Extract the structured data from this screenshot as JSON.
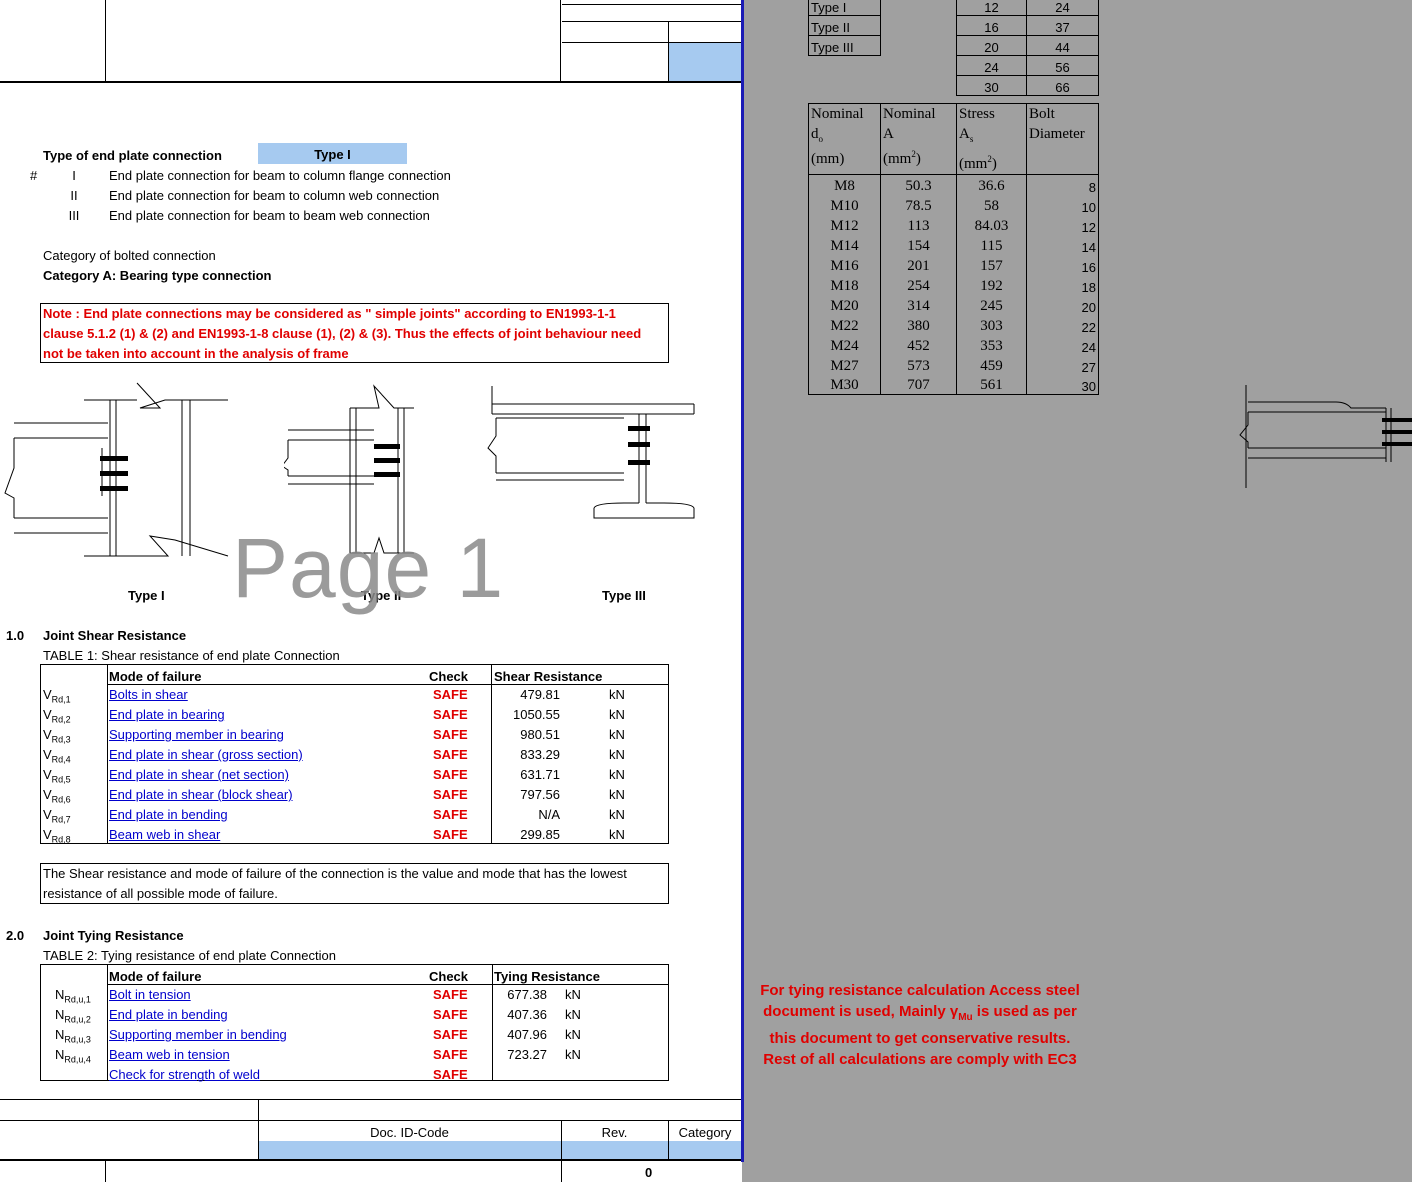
{
  "top_table": [
    {
      "type": "Type I",
      "d": "12",
      "dw": "24"
    },
    {
      "type": "Type II",
      "d": "16",
      "dw": "37"
    },
    {
      "type": "Type III",
      "d": "20",
      "dw": "44"
    },
    {
      "type": "",
      "d": "24",
      "dw": "56"
    },
    {
      "type": "",
      "d": "30",
      "dw": "66"
    }
  ],
  "bolt_table": {
    "headers": [
      "Nominal d₀ (mm)",
      "Nominal A (mm²)",
      "Stress Aₛ (mm²)",
      "Bolt Diameter"
    ],
    "rows": [
      [
        "M8",
        "50.3",
        "36.6",
        "8"
      ],
      [
        "M10",
        "78.5",
        "58",
        "10"
      ],
      [
        "M12",
        "113",
        "84.03",
        "12"
      ],
      [
        "M14",
        "154",
        "115",
        "14"
      ],
      [
        "M16",
        "201",
        "157",
        "16"
      ],
      [
        "M18",
        "254",
        "192",
        "18"
      ],
      [
        "M20",
        "314",
        "245",
        "20"
      ],
      [
        "M22",
        "380",
        "303",
        "22"
      ],
      [
        "M24",
        "452",
        "353",
        "24"
      ],
      [
        "M27",
        "573",
        "459",
        "27"
      ],
      [
        "M30",
        "707",
        "561",
        "30"
      ]
    ]
  },
  "connection": {
    "type_label": "Type of end plate connection",
    "type_value": "Type I",
    "hash": "#",
    "options": [
      {
        "num": "I",
        "text": "End plate connection for beam to column flange connection"
      },
      {
        "num": "II",
        "text": "End plate connection for beam to column web connection"
      },
      {
        "num": "III",
        "text": "End plate connection for beam to beam web connection"
      }
    ],
    "category_label": "Category of bolted connection",
    "category_value": "Category A: Bearing type connection",
    "note_line1": "Note : End plate connections may be considered as \" simple joints\" according to EN1993-1-1",
    "note_line2": "clause 5.1.2 (1) & (2) and EN1993-1-8 clause (1), (2) & (3). Thus the effects of joint behaviour need",
    "note_line3": "not be taken into account in the analysis of frame"
  },
  "figures": {
    "type1": "Type I",
    "type2": "Type II",
    "type3": "Type III"
  },
  "watermark": "Page 1",
  "section1": {
    "num": "1.0",
    "title": "Joint Shear Resistance",
    "table_title": "TABLE 1: Shear resistance of end plate Connection",
    "col_mode": "Mode of failure",
    "col_check": "Check",
    "col_res": "Shear Resistance",
    "rows": [
      {
        "sym": "V",
        "sub": "Rd,1",
        "mode": "Bolts in shear ",
        "check": "SAFE",
        "val": "479.81",
        "unit": "kN"
      },
      {
        "sym": "V",
        "sub": "Rd,2",
        "mode": "End plate in bearing",
        "check": "SAFE",
        "val": "1050.55",
        "unit": "kN"
      },
      {
        "sym": "V",
        "sub": "Rd,3",
        "mode": "Supporting member in bearing",
        "check": "SAFE",
        "val": "980.51",
        "unit": "kN"
      },
      {
        "sym": "V",
        "sub": "Rd,4",
        "mode": "End plate in shear (gross section)",
        "check": "SAFE",
        "val": "833.29",
        "unit": "kN"
      },
      {
        "sym": "V",
        "sub": "Rd,5",
        "mode": "End plate in shear (net section)",
        "check": "SAFE",
        "val": "631.71",
        "unit": "kN"
      },
      {
        "sym": "V",
        "sub": "Rd,6",
        "mode": "End plate in shear (block shear)",
        "check": "SAFE",
        "val": "797.56",
        "unit": "kN"
      },
      {
        "sym": "V",
        "sub": "Rd,7",
        "mode": "End plate in bending",
        "check": "SAFE",
        "val": "N/A",
        "unit": "kN"
      },
      {
        "sym": "V",
        "sub": "Rd,8",
        "mode": "Beam web in shear",
        "check": "SAFE",
        "val": "299.85",
        "unit": "kN"
      }
    ],
    "info_line1": "The Shear resistance and mode of failure of the connection is the value and mode that has the lowest",
    "info_line2": "resistance of all possible mode of failure."
  },
  "section2": {
    "num": "2.0",
    "title": "Joint Tying Resistance",
    "table_title": "TABLE 2: Tying resistance of end plate Connection",
    "col_mode": "Mode of failure",
    "col_check": "Check",
    "col_res": "Tying Resistance",
    "rows": [
      {
        "sym": "N",
        "sub": "Rd,u,1",
        "mode": "Bolt in tension",
        "check": "SAFE",
        "val": "677.38",
        "unit": "kN"
      },
      {
        "sym": "N",
        "sub": "Rd,u,2",
        "mode": "End plate in bending",
        "check": "SAFE",
        "val": "407.36",
        "unit": "kN"
      },
      {
        "sym": "N",
        "sub": "Rd,u,3",
        "mode": "Supporting member in bending",
        "check": "SAFE",
        "val": "407.96",
        "unit": "kN"
      },
      {
        "sym": "N",
        "sub": "Rd,u,4",
        "mode": "Beam web in tension",
        "check": "SAFE",
        "val": "723.27",
        "unit": "kN"
      },
      {
        "sym": "",
        "sub": "",
        "mode": "Check for strength of weld",
        "check": "SAFE",
        "val": "",
        "unit": ""
      }
    ]
  },
  "footer": {
    "doc_id_label": "Doc. ID-Code",
    "rev_label": "Rev.",
    "category_label": "Category",
    "rev_value": "0"
  },
  "side_note": {
    "line1": "For tying resistance calculation Access steel",
    "line2a": "document is used, Mainly ",
    "gamma": "γ",
    "gamma_sub": "Mu",
    "line2b": " is used as per",
    "line3": "this document to get conservative results.",
    "line4": "Rest of all calculations are comply with EC3"
  },
  "colors": {
    "accent_blue": "#a6caf0",
    "page_border": "#1b1bb5",
    "safe_red": "#e00000",
    "link_blue": "#0000cc",
    "background_gray": "#a0a0a0"
  }
}
